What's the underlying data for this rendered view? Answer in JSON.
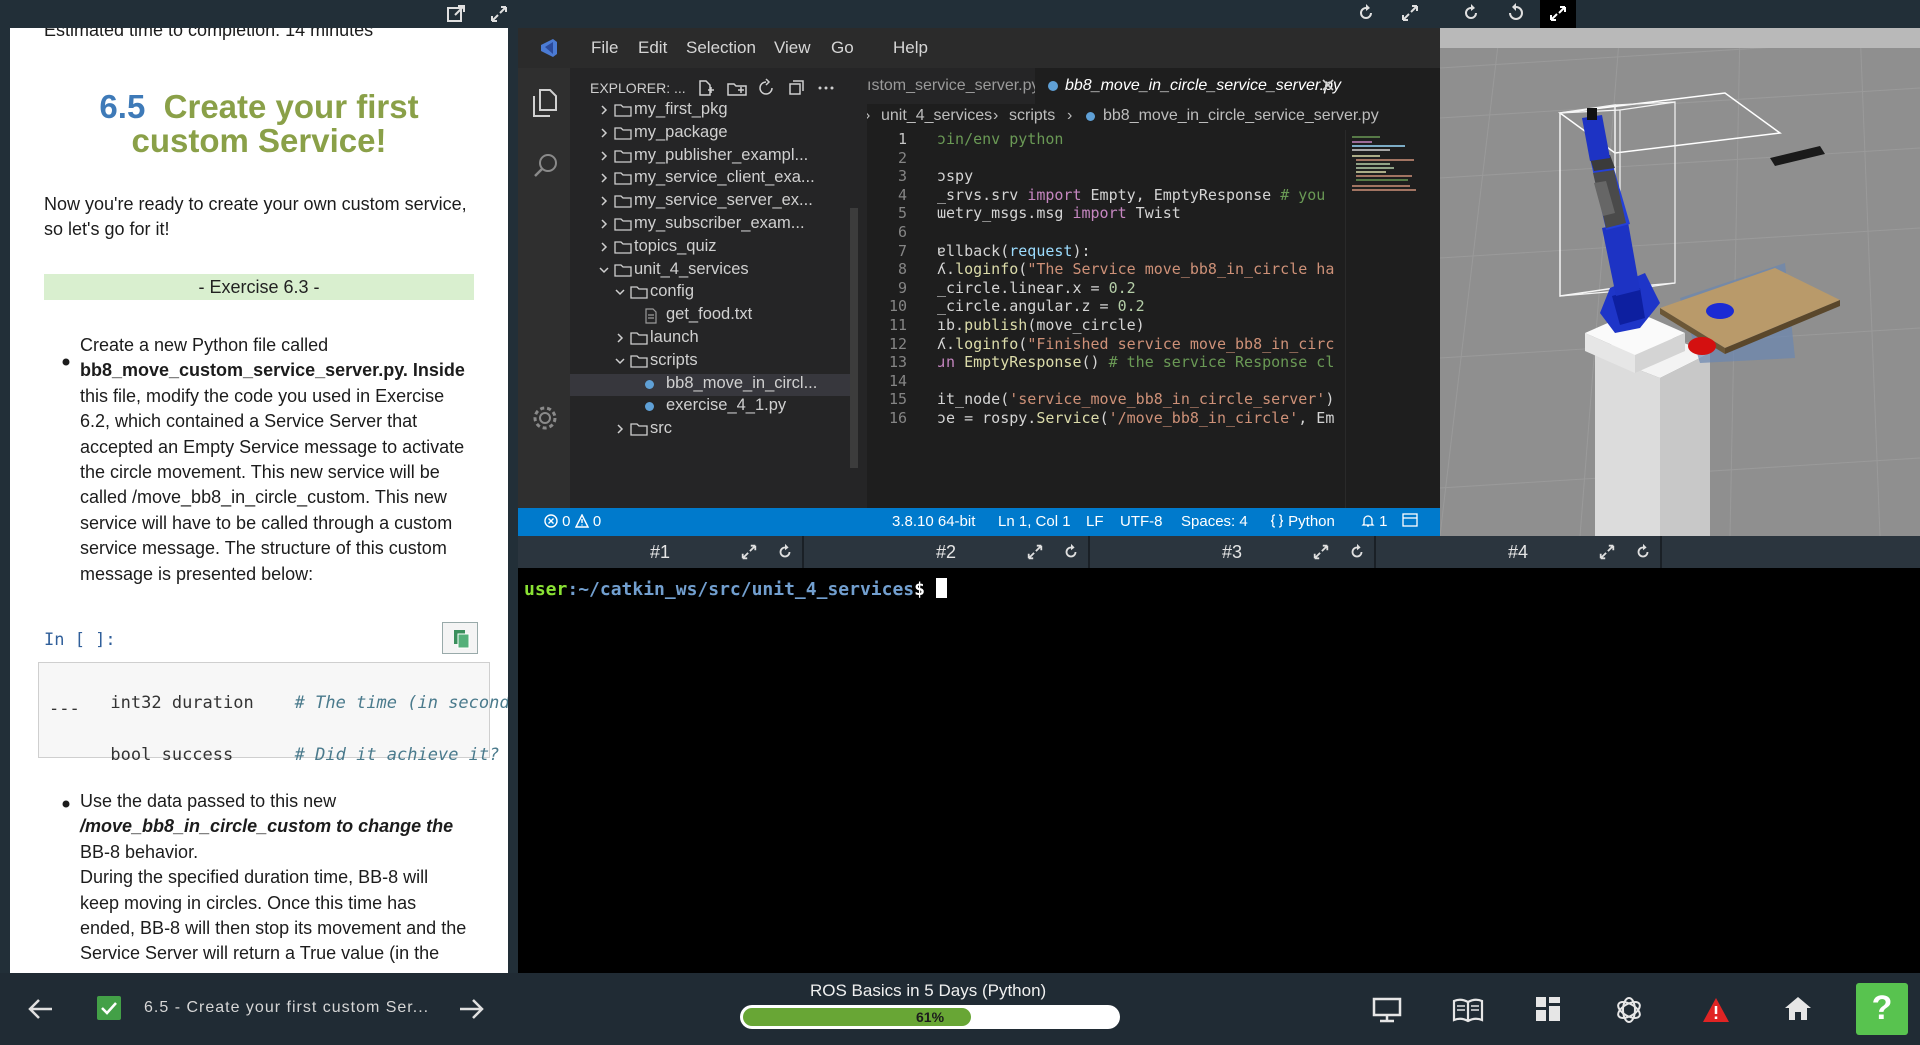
{
  "notebook": {
    "cut_top_text": "Estimated time to completion: 14 minutes",
    "heading_number": "6.5",
    "heading_title_line1": "Create your first",
    "heading_title_line2": "custom Service!",
    "intro_line1": "Now you're ready to create your own custom service,",
    "intro_line2": "so let's go for it!",
    "exercise_label": "- Exercise 6.3 -",
    "bullet1_lines": [
      "Create a new Python file called",
      "bb8_move_custom_service_server.py. Inside",
      "this file, modify the code you used in Exercise",
      "6.2, which contained a Service Server that",
      "accepted an Empty Service message to activate",
      "the circle movement. This new service will be",
      "called /move_bb8_in_circle_custom. This new",
      "service will have to be called through a custom",
      "service message. The structure of this custom",
      "message is presented below:"
    ],
    "cell_prompt": "In [ ]:",
    "code_line1_code": "int32 duration",
    "code_line1_comment": "# The time (in second:",
    "code_line2": "---",
    "code_line3_code": "bool success",
    "code_line3_comment": "# Did it achieve it?",
    "bullet2_lines": [
      "Use the data passed to this new",
      "/move_bb8_in_circle_custom to change the",
      "BB-8 behavior.",
      "During the specified duration time, BB-8 will",
      "keep moving in circles. Once this time has",
      "ended, BB-8 will then stop its movement and the",
      "Service Server will return a True value (in the"
    ]
  },
  "vscode": {
    "menu": [
      "File",
      "Edit",
      "Selection",
      "View",
      "Go",
      "Help"
    ],
    "explorer_label": "EXPLORER: ...",
    "tree": [
      {
        "label": "my_first_pkg",
        "type": "folder",
        "indent": 1,
        "open": false
      },
      {
        "label": "my_package",
        "type": "folder",
        "indent": 1,
        "open": false
      },
      {
        "label": "my_publisher_exampl...",
        "type": "folder",
        "indent": 1,
        "open": false
      },
      {
        "label": "my_service_client_exa...",
        "type": "folder",
        "indent": 1,
        "open": false
      },
      {
        "label": "my_service_server_ex...",
        "type": "folder",
        "indent": 1,
        "open": false
      },
      {
        "label": "my_subscriber_exam...",
        "type": "folder",
        "indent": 1,
        "open": false
      },
      {
        "label": "topics_quiz",
        "type": "folder",
        "indent": 1,
        "open": false
      },
      {
        "label": "unit_4_services",
        "type": "folder",
        "indent": 1,
        "open": true
      },
      {
        "label": "config",
        "type": "folder",
        "indent": 2,
        "open": true
      },
      {
        "label": "get_food.txt",
        "type": "file",
        "indent": 3,
        "open": false
      },
      {
        "label": "launch",
        "type": "folder",
        "indent": 2,
        "open": false
      },
      {
        "label": "scripts",
        "type": "folder",
        "indent": 2,
        "open": true
      },
      {
        "label": "bb8_move_in_circl...",
        "type": "py",
        "indent": 3,
        "open": false
      },
      {
        "label": "exercise_4_1.py",
        "type": "py",
        "indent": 3,
        "open": false
      },
      {
        "label": "src",
        "type": "folder",
        "indent": 2,
        "open": false
      }
    ],
    "tab_inactive": "ıstom_service_server.py",
    "tab_active": "bb8_move_in_circle_service_server.py",
    "breadcrumb": [
      "unit_4_services",
      "scripts",
      "bb8_move_in_circle_service_server.py"
    ],
    "code_lines": [
      {
        "n": "1",
        "html": "<span class='cmt'>ɔin/env python</span>"
      },
      {
        "n": "2",
        "html": ""
      },
      {
        "n": "3",
        "html": "ɔspy"
      },
      {
        "n": "4",
        "html": "_srvs.srv <span class='kw'>import</span> Empty, EmptyResponse <span class='cmt'># you</span>"
      },
      {
        "n": "5",
        "html": "ɯetry_msgs.msg <span class='kw'>import</span> Twist"
      },
      {
        "n": "6",
        "html": ""
      },
      {
        "n": "7",
        "html": "ɐllback(<span class='par'>request</span>):"
      },
      {
        "n": "8",
        "html": "ʎ.<span class='fn'>loginfo</span>(<span class='str'>\"The Service move_bb8_in_circle ha</span>"
      },
      {
        "n": "9",
        "html": "_circle.linear.x = <span class='num'>0.2</span>"
      },
      {
        "n": "10",
        "html": "_circle.angular.z = <span class='num'>0.2</span>"
      },
      {
        "n": "11",
        "html": "ıb.<span class='fn'>publish</span>(move_circle)"
      },
      {
        "n": "12",
        "html": "ʎ.<span class='fn'>loginfo</span>(<span class='str'>\"Finished service move_bb8_in_circ</span>"
      },
      {
        "n": "13",
        "html": "<span class='kw'>ɹn</span> <span class='fn'>EmptyResponse</span>() <span class='cmt'># the service Response cl</span>"
      },
      {
        "n": "14",
        "html": ""
      },
      {
        "n": "15",
        "html": "it_node(<span class='str'>'service_move_bb8_in_circle_server'</span>)"
      },
      {
        "n": "16",
        "html": "ɔe = rospy.<span class='fn'>Service</span>(<span class='str'>'/move_bb8_in_circle'</span>, Em"
      }
    ],
    "status": {
      "errors": "0",
      "warnings": "0",
      "python_version": "3.8.10 64-bit",
      "position": "Ln 1, Col 1",
      "eol": "LF",
      "encoding": "UTF-8",
      "spaces": "Spaces: 4",
      "language": "Python",
      "notifications": "1"
    }
  },
  "terminals": {
    "tabs": [
      "#1",
      "#2",
      "#3",
      "#4"
    ],
    "prompt_user": "user",
    "prompt_path": ":~/catkin_ws/src/unit_4_services",
    "prompt_symbol": "$"
  },
  "bottom_bar": {
    "lesson_title": "6.5 - Create your first custom Ser...",
    "course_title": "ROS Basics in 5 Days (Python)",
    "progress_percent": 61,
    "progress_label": "61%",
    "help_label": "?"
  },
  "colors": {
    "heading_green": "#8aa048",
    "heading_blue": "#3e7ab8",
    "status_blue": "#007acc",
    "progress_green": "#68a635",
    "help_green": "#58c34f",
    "prompt_green": "#8ae234",
    "prompt_blue": "#729fcf"
  }
}
